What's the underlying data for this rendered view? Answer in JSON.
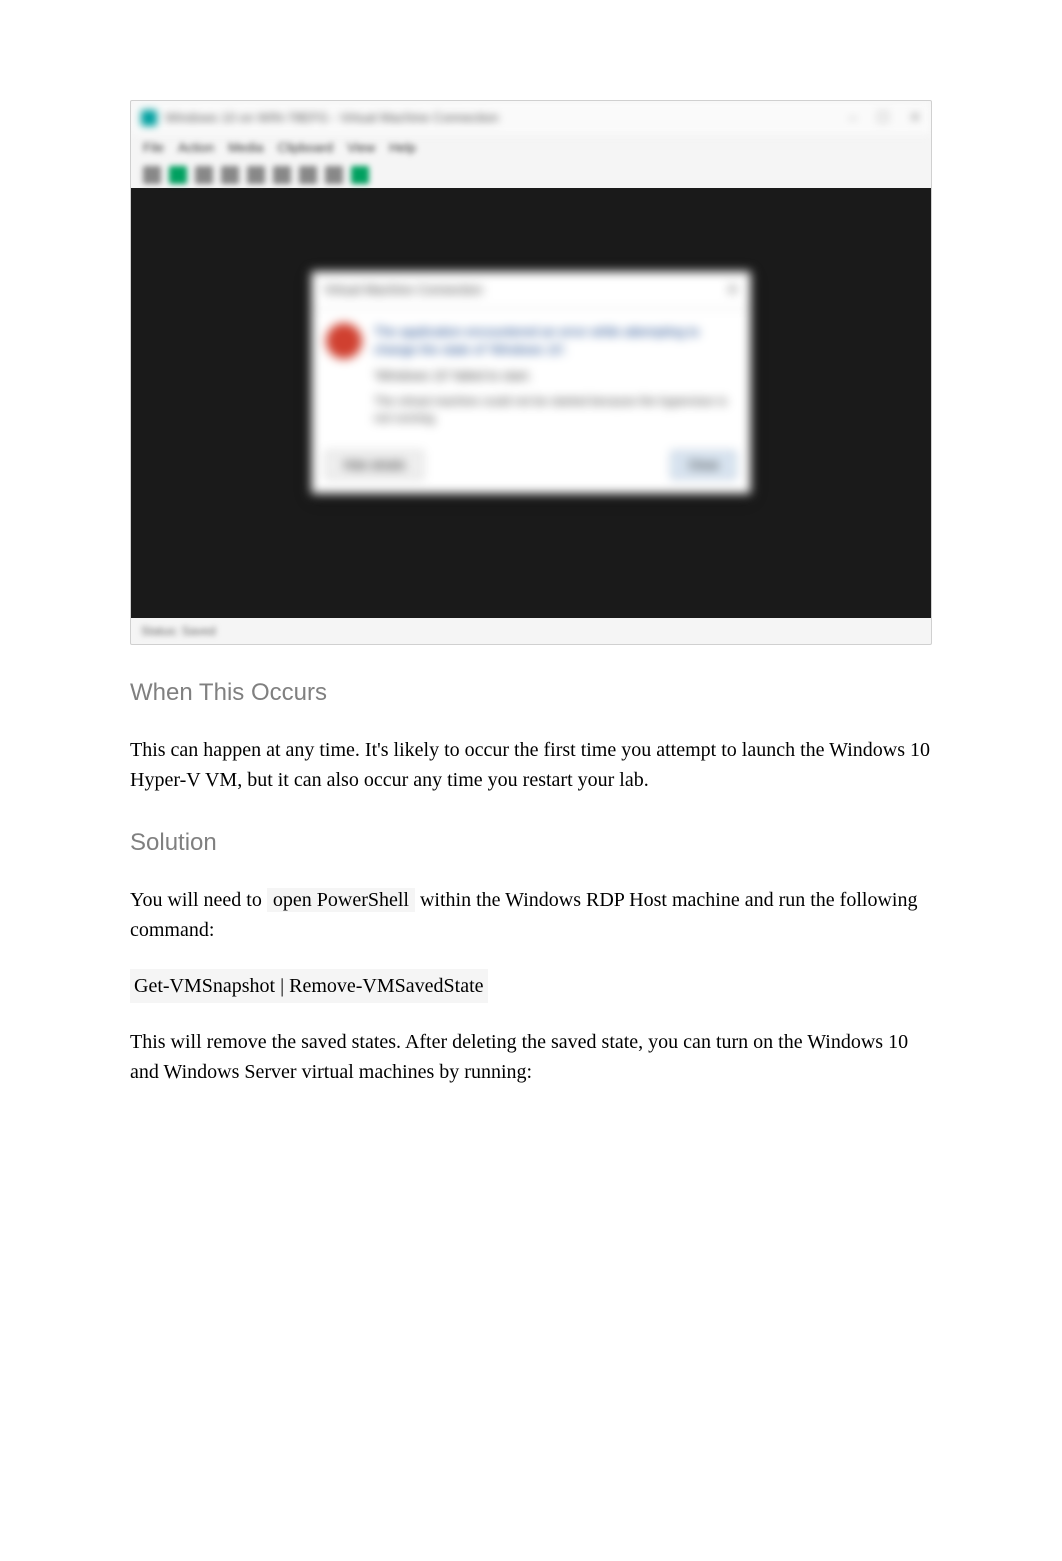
{
  "screenshot": {
    "window_title": "Windows 10 on WIN-78EFG - Virtual Machine Connection",
    "menubar": [
      "File",
      "Action",
      "Media",
      "Clipboard",
      "View",
      "Help"
    ],
    "dialog": {
      "title": "Virtual Machine Connection",
      "error_heading": "The application encountered an error while attempting to change the state of 'Windows 10'.",
      "error_sub1": "'Windows 10' failed to start.",
      "error_sub2": "The virtual machine could not be started because the hypervisor is not running.",
      "hide_details": "Hide details",
      "close": "Close"
    },
    "status": "Status: Saved"
  },
  "headings": {
    "when_occurs": "When This Occurs",
    "solution": "Solution"
  },
  "paragraphs": {
    "when_text": "This can happen at any time. It's likely to occur the first time you attempt to launch the Windows 10 Hyper-V VM, but it can also occur any time you restart your lab.",
    "solution_pre": "You will need to ",
    "solution_code_inline": "open PowerShell",
    "solution_post": " within the Windows RDP Host machine and run the following command:",
    "command": "Get-VMSnapshot | Remove-VMSavedState",
    "after_text": "This will remove the saved states. After deleting the saved state, you can turn on the Windows 10 and Windows Server virtual machines by running:"
  }
}
